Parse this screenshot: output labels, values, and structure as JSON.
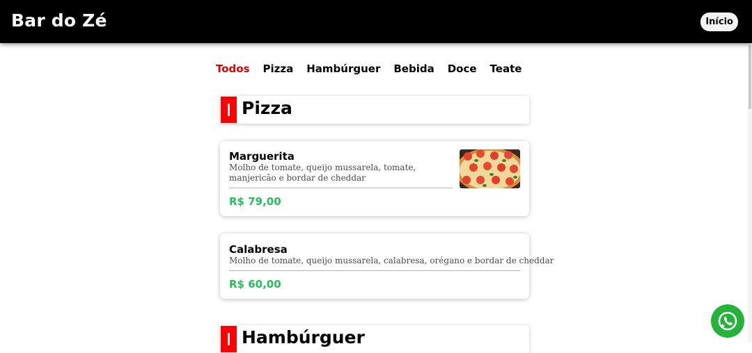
{
  "header": {
    "brand": "Bar do Zé",
    "home_button": "Início"
  },
  "categories": [
    "Todos",
    "Pizza",
    "Hambúrguer",
    "Bebida",
    "Doce",
    "Teate"
  ],
  "sections": [
    {
      "title": "Pizza",
      "items": [
        {
          "name": "Marguerita",
          "description": "Molho de tomate, queijo mussarela, tomate, manjericão e bordar de cheddar",
          "price": "R$ 79,00",
          "image": "pizza-photo"
        },
        {
          "name": "Calabresa",
          "description": "Molho de tomate, queijo mussarela, calabresa, orégano e bordar de cheddar",
          "price": "R$ 60,00"
        }
      ]
    },
    {
      "title": "Hambúrguer"
    }
  ],
  "colors": {
    "header_bg": "#000000",
    "accent_red": "#ff0000",
    "active_tab": "#e00000",
    "price_green": "#25c05a",
    "whatsapp_green": "#25b33c"
  },
  "icons": {
    "whatsapp": "whatsapp-icon"
  }
}
